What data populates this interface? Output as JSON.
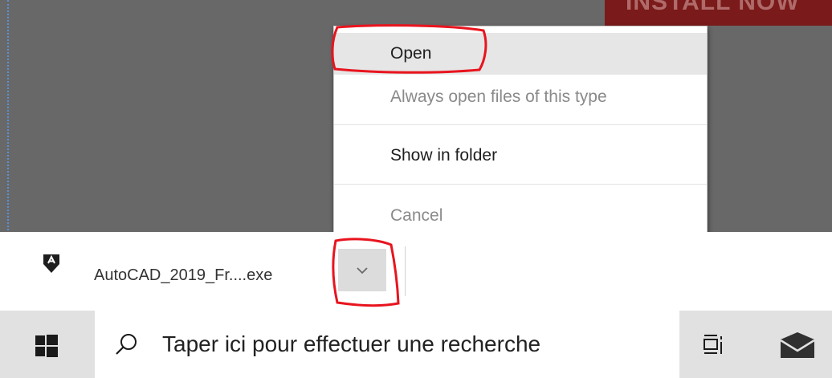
{
  "banner": {
    "label": "INSTALL NOW"
  },
  "context_menu": {
    "items": [
      {
        "label": "Open",
        "enabled": true,
        "hovered": true
      },
      {
        "label": "Always open files of this type",
        "enabled": false
      },
      {
        "label": "Show in folder",
        "enabled": true
      },
      {
        "label": "Cancel",
        "enabled": false
      }
    ]
  },
  "download_shelf": {
    "file_name": "AutoCAD_2019_Fr....exe",
    "file_icon": "autocad-icon",
    "menu_button_icon": "chevron-down-icon"
  },
  "taskbar": {
    "start_icon": "windows-logo-icon",
    "search_placeholder": "Taper ici pour effectuer une recherche",
    "search_icon": "search-icon",
    "task_view_icon": "task-view-icon",
    "mail_icon": "mail-icon"
  },
  "colors": {
    "page_background": "#686868",
    "banner_background": "#7a1a1a",
    "annotation": "#e8141e",
    "taskbar": "#e1e1e1",
    "hover": "#e6e6e6"
  }
}
